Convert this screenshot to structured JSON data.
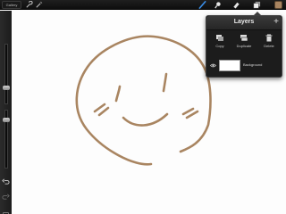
{
  "toolbar": {
    "gallery_label": "Gallery",
    "tools": [
      "wrench-icon",
      "magic-wand-icon",
      "brush-icon",
      "smudge-icon",
      "eraser-icon",
      "layers-icon"
    ],
    "current_color": "#a98561"
  },
  "sidebar": {
    "controls": [
      "brush-size-slider",
      "opacity-slider",
      "undo-icon",
      "redo-icon",
      "modify-button"
    ]
  },
  "layers_panel": {
    "title": "Layers",
    "add_symbol": "+",
    "actions": [
      {
        "label": "Copy"
      },
      {
        "label": "Duplicate"
      },
      {
        "label": "Delete"
      }
    ],
    "layers": [
      {
        "name": "Background",
        "visible": true
      }
    ]
  },
  "canvas": {
    "stroke_color": "#a98561",
    "background": "#ffffff"
  }
}
